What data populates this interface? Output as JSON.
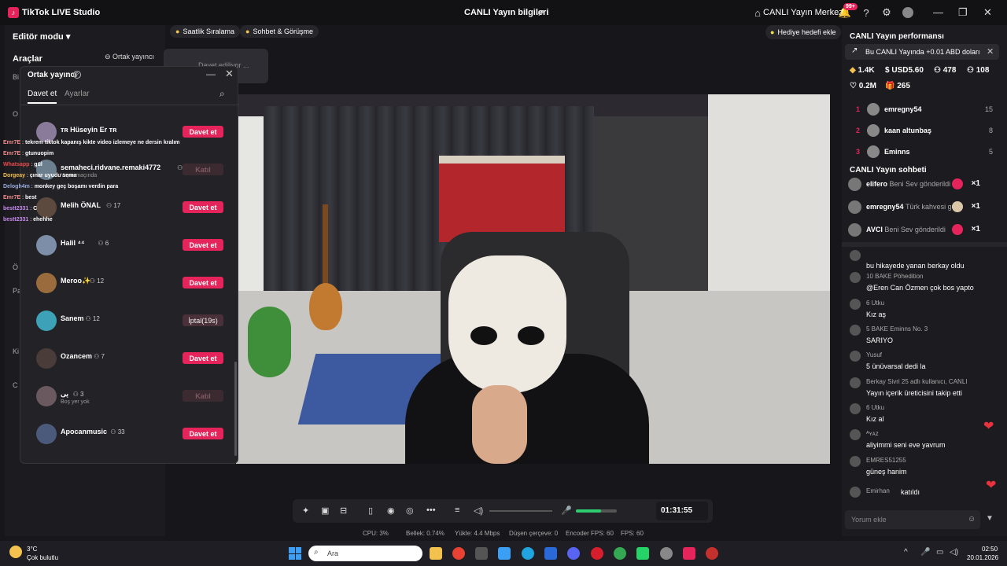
{
  "titlebar": {
    "app_title": "TikTok LIVE Studio",
    "center_title": "CANLI Yayın bilgileri",
    "live_center": "CANLI Yayın Merkezi",
    "notif_badge": "99+"
  },
  "left": {
    "edit_mode": "Editör modu ▾",
    "tools": "Araçlar",
    "cohost_button": "⊖ Ortak yayıncı",
    "side_letters": [
      "Bi",
      "O",
      "Et",
      "Ö",
      "Pa",
      "Ki",
      "C"
    ]
  },
  "chips": {
    "hourly_rank": "Saatlik Sıralama",
    "chat_meet": "Sohbet & Görüşme",
    "gift_goal": "Hediye hedefi ekle"
  },
  "ghost_card": "Davet ediliyor ...",
  "popup": {
    "title": "Ortak yayıncı",
    "tab_invite": "Davet et",
    "tab_settings": "Ayarlar",
    "rows": [
      {
        "name": "ᴛʀ Hüseyin Er ᴛʀ",
        "count": "",
        "sub": "",
        "button": "Davet et",
        "type": "invite"
      },
      {
        "name": "semaheci.ridvane.remaki4772",
        "count": "8",
        "sub": "Yayın maçında",
        "button": "Katıl",
        "type": "join"
      },
      {
        "name": "Melih ÖNAL",
        "count": "17",
        "sub": "",
        "button": "Davet et",
        "type": "invite"
      },
      {
        "name": "Halil ⁴⁴",
        "count": "6",
        "sub": "",
        "button": "Davet et",
        "type": "invite"
      },
      {
        "name": "Meroo✨",
        "count": "12",
        "sub": "",
        "button": "Davet et",
        "type": "invite"
      },
      {
        "name": "Sanem",
        "count": "12",
        "sub": "",
        "button": "İptal(19s)",
        "type": "cancel"
      },
      {
        "name": "Ozancem",
        "count": "7",
        "sub": "",
        "button": "Davet et",
        "type": "invite"
      },
      {
        "name": "بى",
        "count": "3",
        "sub": "Boş yer yok",
        "button": "Katıl",
        "type": "join"
      },
      {
        "name": "Apocanmusic",
        "count": "33",
        "sub": "",
        "button": "Davet et",
        "type": "invite"
      }
    ]
  },
  "overlay_chat": [
    {
      "user": "Emr7E",
      "msg": "tekrem tiktok kapanış kikte video izlemeye ne dersin kralım"
    },
    {
      "user": "Emr7E",
      "msg": "gtunuopim"
    },
    {
      "user": "Whatsapp",
      "msg": "gül"
    },
    {
      "user": "Dorgeay",
      "msg": "çınar uyudu sema"
    },
    {
      "user": "Delogh4m",
      "msg": "monkey geç boşamı verdin para"
    },
    {
      "user": "Emr7E",
      "msg": "best"
    },
    {
      "user": "bestt2331",
      "msg": "C"
    },
    {
      "user": "bestt2331",
      "msg": "ehehhe"
    }
  ],
  "toolbar": {
    "timer": "01:31:55"
  },
  "stats": {
    "cpu": "CPU: 3%",
    "memory": "Bellek: 0.74%",
    "upload": "Yükle: 4.4 Mbps",
    "dropped": "Düşen çerçeve: 0",
    "encoder_fps": "Encoder FPS: 60",
    "fps": "FPS: 60"
  },
  "right": {
    "perf_title": "CANLI Yayın performansı",
    "banner": "Bu CANLI Yayında +0.01 ABD doları",
    "stats": {
      "diamonds": "1.4K",
      "usd": "USD5.60",
      "viewers": "478",
      "followers": "108",
      "likes": "0.2M",
      "gifters": "265"
    },
    "ranking": [
      {
        "rank": "1",
        "name": "emregny54",
        "score": "15"
      },
      {
        "rank": "2",
        "name": "kaan altunbaş",
        "score": "8"
      },
      {
        "rank": "3",
        "name": "Eminns",
        "score": "5"
      }
    ],
    "chat_title": "CANLI Yayın sohbeti",
    "gifts": [
      {
        "name": "elifero",
        "action": "Beni Sev gönderildi",
        "count": "×1"
      },
      {
        "name": "emregny54",
        "action": "Türk kahvesi gönc",
        "count": "×1"
      },
      {
        "name": "AVCI",
        "action": "Beni Sev gönderildi",
        "count": "×1"
      }
    ],
    "messages": [
      {
        "meta": "",
        "text": "bu hikayede yanan berkay oldu"
      },
      {
        "meta": "10 BAKE Pöhedition",
        "text": "@Eren Can Özmen çok bos yapto"
      },
      {
        "meta": "6 Utku",
        "text": "Kız aş"
      },
      {
        "meta": "5 BAKE Eminns No. 3",
        "text": "SARIYO"
      },
      {
        "meta": "Yusuf",
        "text": "5 ünüvarsal dedi la"
      },
      {
        "meta": "Berkay Sivri 25 adlı kullanıcı, CANLI",
        "text": "Yayın içerik üreticisini takip etti"
      },
      {
        "meta": "6 Utku",
        "text": "Kız al"
      },
      {
        "meta": "ᴬʏᴀᴢ",
        "text": "aliyimmi seni eve yavrum"
      },
      {
        "meta": "EMRES51255",
        "text": "güneş hanim"
      },
      {
        "meta": "Emirhan",
        "text": "katıldı"
      }
    ],
    "comment_placeholder": "Yorum ekle"
  },
  "taskbar": {
    "temp": "3°C",
    "weather": "Çok bulutlu",
    "search": "Ara",
    "time": "02:50",
    "date": "20.01.2026"
  }
}
